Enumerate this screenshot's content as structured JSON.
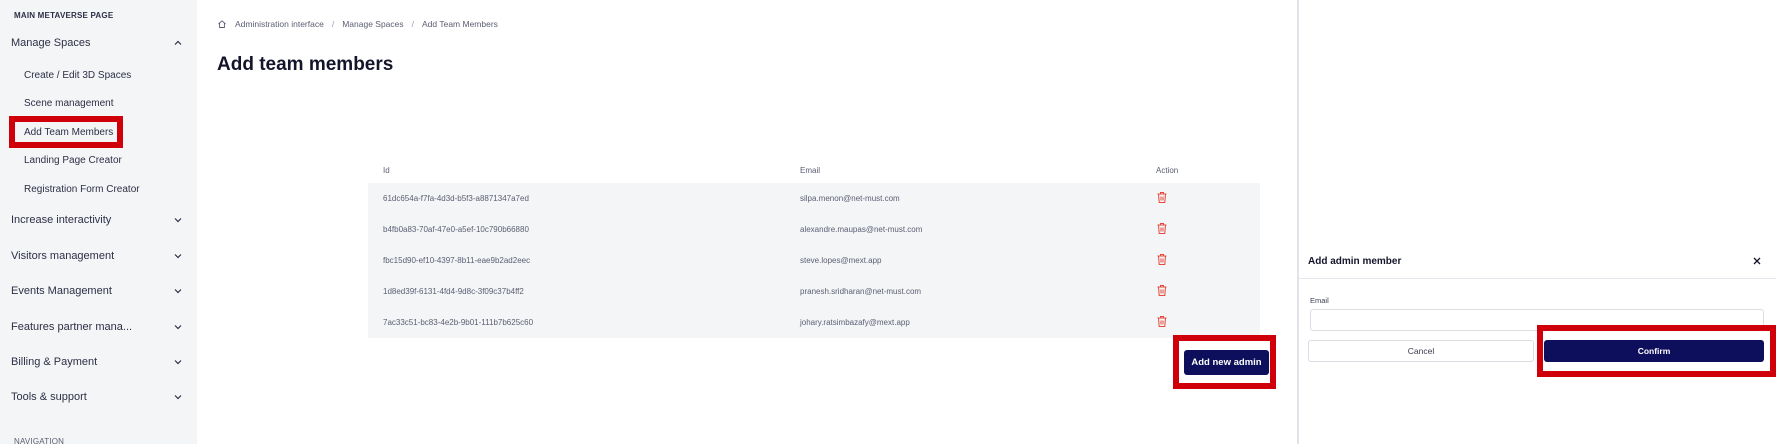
{
  "sidebar": {
    "section_title": "MAIN METAVERSE PAGE",
    "manage_spaces": {
      "label": "Manage Spaces",
      "items": [
        {
          "label": "Create / Edit 3D Spaces"
        },
        {
          "label": "Scene management"
        },
        {
          "label": "Add Team Members"
        },
        {
          "label": "Landing Page Creator"
        },
        {
          "label": "Registration Form Creator"
        }
      ]
    },
    "groups": [
      {
        "label": "Increase interactivity"
      },
      {
        "label": "Visitors management"
      },
      {
        "label": "Events Management"
      },
      {
        "label": "Features partner mana..."
      },
      {
        "label": "Billing & Payment"
      },
      {
        "label": "Tools & support"
      }
    ],
    "footer_section": "NAVIGATION"
  },
  "breadcrumb": {
    "items": [
      "Administration interface",
      "Manage Spaces",
      "Add Team Members"
    ],
    "separator": "/"
  },
  "page": {
    "title": "Add team members"
  },
  "table": {
    "columns": {
      "id": "Id",
      "email": "Email",
      "action": "Action"
    },
    "rows": [
      {
        "id": "61dc654a-f7fa-4d3d-b5f3-a8871347a7ed",
        "email": "silpa.menon@net-must.com"
      },
      {
        "id": "b4fb0a83-70af-47e0-a5ef-10c790b66880",
        "email": "alexandre.maupas@net-must.com"
      },
      {
        "id": "fbc15d90-ef10-4397-8b11-eae9b2ad2eec",
        "email": "steve.lopes@mext.app"
      },
      {
        "id": "1d8ed39f-6131-4fd4-9d8c-3f09c37b4ff2",
        "email": "pranesh.sridharan@net-must.com"
      },
      {
        "id": "7ac33c51-bc83-4e2b-9b01-111b7b625c60",
        "email": "johary.ratsimbazafy@mext.app"
      }
    ]
  },
  "add_button": {
    "label": "Add new admin"
  },
  "panel": {
    "title": "Add admin member",
    "email_label": "Email",
    "email_value": "",
    "cancel_label": "Cancel",
    "confirm_label": "Confirm"
  },
  "colors": {
    "accent": "#0d0f5c",
    "highlight": "#d0000a",
    "danger_icon": "#e5483b",
    "sidebar_bg": "#f4f5f7"
  },
  "icons": {
    "home": "home-icon",
    "chevron_up": "chevron-up-icon",
    "chevron_down": "chevron-down-icon",
    "trash": "trash-icon",
    "close": "close-icon"
  }
}
